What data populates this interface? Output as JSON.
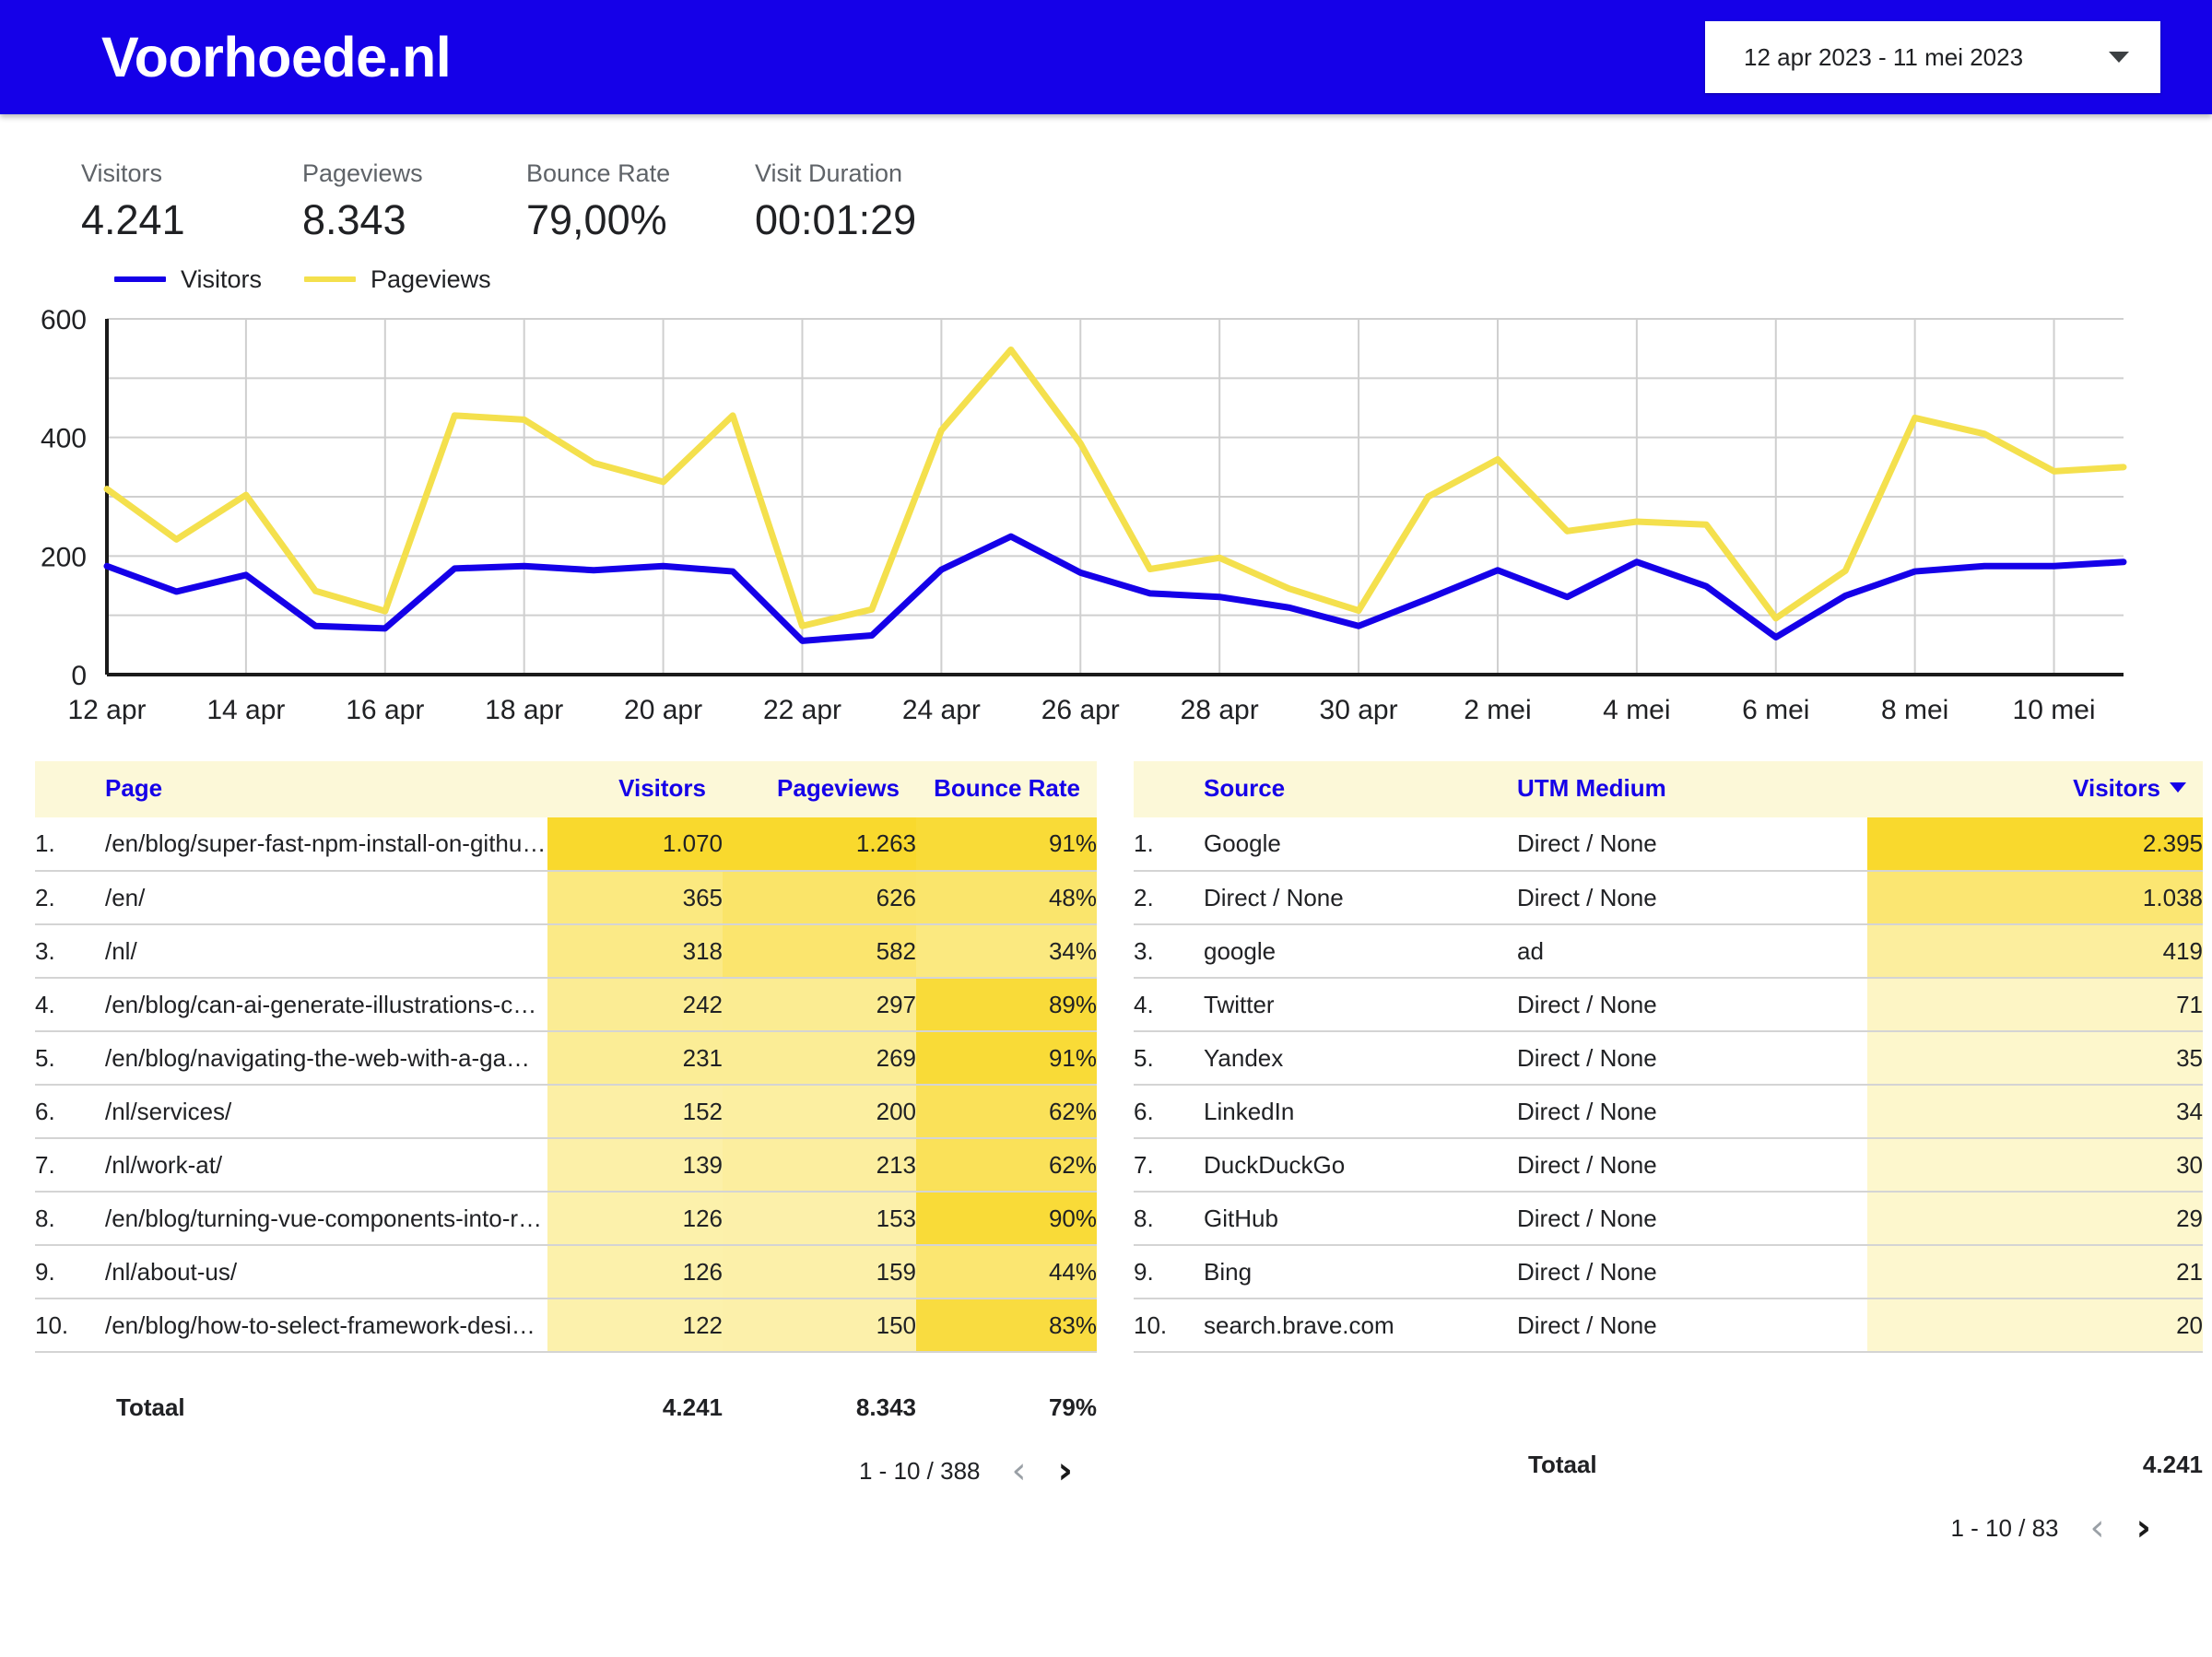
{
  "header": {
    "title": "Voorhoede.nl",
    "brand_color": "#1500E8",
    "date_range": "12 apr 2023 - 11 mei 2023",
    "caret_icon": "chevron-down-icon"
  },
  "scorecards": [
    {
      "label": "Visitors",
      "value": "4.241"
    },
    {
      "label": "Pageviews",
      "value": "8.343"
    },
    {
      "label": "Bounce Rate",
      "value": "79,00%"
    },
    {
      "label": "Visit Duration",
      "value": "00:01:29"
    }
  ],
  "chart_data": {
    "type": "line",
    "title": "",
    "xlabel": "",
    "ylabel": "",
    "ylim": [
      0,
      600
    ],
    "yticks": [
      0,
      200,
      400,
      600
    ],
    "ytick_labels": [
      "0",
      "200",
      "400",
      "600"
    ],
    "minor_gridlines": [
      100,
      200,
      300,
      400,
      500
    ],
    "grid": true,
    "legend_position": "top-left",
    "x": [
      "12 apr",
      "13 apr",
      "14 apr",
      "15 apr",
      "16 apr",
      "17 apr",
      "18 apr",
      "19 apr",
      "20 apr",
      "21 apr",
      "22 apr",
      "23 apr",
      "24 apr",
      "25 apr",
      "26 apr",
      "27 apr",
      "28 apr",
      "29 apr",
      "30 apr",
      "1 mei",
      "2 mei",
      "3 mei",
      "4 mei",
      "5 mei",
      "6 mei",
      "7 mei",
      "8 mei",
      "9 mei",
      "10 mei",
      "11 mei"
    ],
    "xtick_labels": [
      "12 apr",
      "14 apr",
      "16 apr",
      "18 apr",
      "20 apr",
      "22 apr",
      "24 apr",
      "26 apr",
      "28 apr",
      "30 apr",
      "2 mei",
      "4 mei",
      "6 mei",
      "8 mei",
      "10 mei"
    ],
    "series": [
      {
        "name": "Visitors",
        "color": "#1500E8",
        "values": [
          183,
          140,
          168,
          82,
          78,
          179,
          183,
          176,
          183,
          174,
          57,
          66,
          177,
          233,
          172,
          137,
          131,
          113,
          82,
          128,
          176,
          131,
          190,
          149,
          63,
          133,
          174,
          183,
          183,
          190
        ]
      },
      {
        "name": "Pageviews",
        "color": "#F4E04D",
        "values": [
          313,
          228,
          303,
          141,
          107,
          437,
          430,
          357,
          325,
          437,
          82,
          110,
          412,
          548,
          390,
          178,
          197,
          145,
          108,
          300,
          363,
          242,
          258,
          253,
          95,
          175,
          433,
          406,
          343,
          350
        ]
      }
    ]
  },
  "pages_table": {
    "columns": [
      "Page",
      "Visitors",
      "Pageviews",
      "Bounce Rate"
    ],
    "rows": [
      {
        "idx": "1.",
        "page": "/en/blog/super-fast-npm-install-on-github...",
        "visitors": "1.070",
        "pageviews": "1.263",
        "bounce": "91%"
      },
      {
        "idx": "2.",
        "page": "/en/",
        "visitors": "365",
        "pageviews": "626",
        "bounce": "48%"
      },
      {
        "idx": "3.",
        "page": "/nl/",
        "visitors": "318",
        "pageviews": "582",
        "bounce": "34%"
      },
      {
        "idx": "4.",
        "page": "/en/blog/can-ai-generate-illustrations-cus...",
        "visitors": "242",
        "pageviews": "297",
        "bounce": "89%"
      },
      {
        "idx": "5.",
        "page": "/en/blog/navigating-the-web-with-a-game...",
        "visitors": "231",
        "pageviews": "269",
        "bounce": "91%"
      },
      {
        "idx": "6.",
        "page": "/nl/services/",
        "visitors": "152",
        "pageviews": "200",
        "bounce": "62%"
      },
      {
        "idx": "7.",
        "page": "/nl/work-at/",
        "visitors": "139",
        "pageviews": "213",
        "bounce": "62%"
      },
      {
        "idx": "8.",
        "page": "/en/blog/turning-vue-components-into-re...",
        "visitors": "126",
        "pageviews": "153",
        "bounce": "90%"
      },
      {
        "idx": "9.",
        "page": "/nl/about-us/",
        "visitors": "126",
        "pageviews": "159",
        "bounce": "44%"
      },
      {
        "idx": "10.",
        "page": "/en/blog/how-to-select-framework-design...",
        "visitors": "122",
        "pageviews": "150",
        "bounce": "83%"
      }
    ],
    "total_label": "Totaal",
    "total_visitors": "4.241",
    "total_pageviews": "8.343",
    "total_bounce": "79%",
    "pager_label": "1 - 10 / 388",
    "prev_icon": "chevron-left-icon",
    "next_icon": "chevron-right-icon"
  },
  "sources_table": {
    "columns": [
      "Source",
      "UTM Medium",
      "Visitors"
    ],
    "sorted_column": "Visitors",
    "sort_direction": "desc",
    "rows": [
      {
        "idx": "1.",
        "source": "Google",
        "medium": "Direct / None",
        "visitors": "2.395"
      },
      {
        "idx": "2.",
        "source": "Direct / None",
        "medium": "Direct / None",
        "visitors": "1.038"
      },
      {
        "idx": "3.",
        "source": "google",
        "medium": "ad",
        "visitors": "419"
      },
      {
        "idx": "4.",
        "source": "Twitter",
        "medium": "Direct / None",
        "visitors": "71"
      },
      {
        "idx": "5.",
        "source": "Yandex",
        "medium": "Direct / None",
        "visitors": "35"
      },
      {
        "idx": "6.",
        "source": "LinkedIn",
        "medium": "Direct / None",
        "visitors": "34"
      },
      {
        "idx": "7.",
        "source": "DuckDuckGo",
        "medium": "Direct / None",
        "visitors": "30"
      },
      {
        "idx": "8.",
        "source": "GitHub",
        "medium": "Direct / None",
        "visitors": "29"
      },
      {
        "idx": "9.",
        "source": "Bing",
        "medium": "Direct / None",
        "visitors": "21"
      },
      {
        "idx": "10.",
        "source": "search.brave.com",
        "medium": "Direct / None",
        "visitors": "20"
      }
    ],
    "total_label": "Totaal",
    "total_visitors": "4.241",
    "pager_label": "1 - 10 / 83",
    "prev_icon": "chevron-left-icon",
    "next_icon": "chevron-right-icon"
  },
  "theme": {
    "accent_blue": "#1500E8",
    "heat_strong": "#F9DD33",
    "heat_mid": "#FBEC90",
    "heat_weak": "#FDF8D8",
    "header_band": "#FCF8D8",
    "visitors_line": "#1500E8",
    "pageviews_line": "#F4E04D"
  }
}
